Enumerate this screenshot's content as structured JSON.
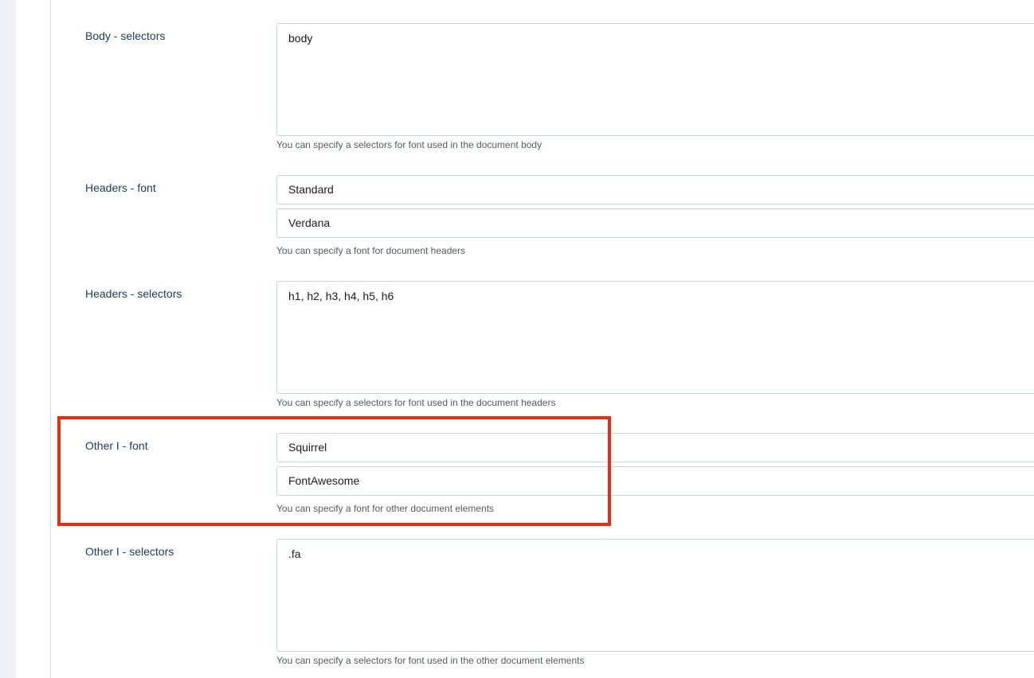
{
  "fields": {
    "body_selectors": {
      "label": "Body - selectors",
      "value": "body",
      "help": "You can specify a selectors for font used in the document body"
    },
    "headers_font": {
      "label": "Headers - font",
      "type_value": "Standard",
      "font_value": "Verdana",
      "help": "You can specify a font for document headers"
    },
    "headers_selectors": {
      "label": "Headers - selectors",
      "value": "h1, h2, h3, h4, h5, h6",
      "help": "You can specify a selectors for font used in the document headers"
    },
    "other1_font": {
      "label": "Other I - font",
      "type_value": "Squirrel",
      "font_value": "FontAwesome",
      "help": "You can specify a font for other document elements"
    },
    "other1_selectors": {
      "label": "Other I - selectors",
      "value": ".fa",
      "help": "You can specify a selectors for font used in the other document elements"
    }
  },
  "colors": {
    "label_text": "#1f3a5a",
    "field_border": "#c9d3de",
    "highlight": "#ee2a0f",
    "side_strip": "#eef2f7"
  }
}
